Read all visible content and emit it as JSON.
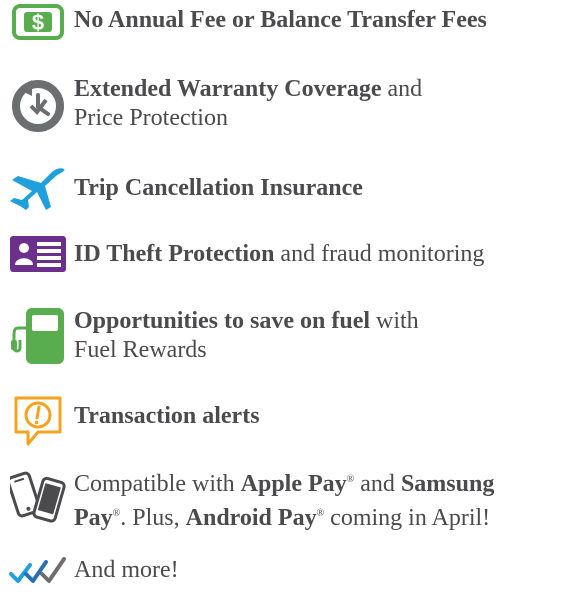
{
  "colors": {
    "text": "#4b4b4d",
    "green": "#5aad4e",
    "gray": "#6d6e70",
    "blue": "#1f9fdb",
    "purple": "#6b2f8c",
    "fuel": "#5aad4e",
    "orange": "#f5a21f"
  },
  "features": [
    {
      "icon": "dollar-icon",
      "bold": "No Annual Fee or Balance Transfer Fees",
      "rest": ""
    },
    {
      "icon": "warranty-clock-icon",
      "bold": "Extended Warranty Coverage",
      "rest": " and",
      "line2": "Price Protection"
    },
    {
      "icon": "airplane-icon",
      "bold": "Trip Cancellation Insurance",
      "rest": ""
    },
    {
      "icon": "id-card-icon",
      "bold": "ID Theft Protection",
      "rest": " and fraud monitoring"
    },
    {
      "icon": "fuel-pump-icon",
      "bold": "Opportunities to save on fuel",
      "rest": " with",
      "line2": "Fuel Rewards"
    },
    {
      "icon": "alert-bubble-icon",
      "bold": "Transaction alerts",
      "rest": ""
    },
    {
      "icon": "phones-icon",
      "pre": "Compatible with ",
      "apple": "Apple Pay",
      "reg": "®",
      "mid": " and ",
      "samsung": "Samsung",
      "line2_bold": "Pay",
      "line2_mid": ". Plus, ",
      "android": "Android Pay",
      "line2_end": " coming in April!"
    },
    {
      "icon": "checkmarks-icon",
      "rest": "And more!"
    }
  ]
}
